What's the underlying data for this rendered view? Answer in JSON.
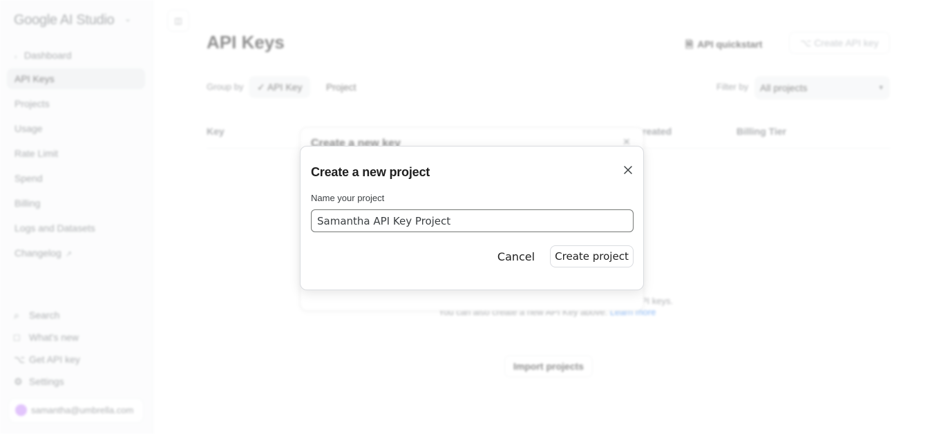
{
  "sidebar": {
    "logo": "Google AI Studio",
    "items": [
      {
        "label": "Dashboard"
      },
      {
        "label": "API Keys"
      },
      {
        "label": "Projects"
      },
      {
        "label": "Usage"
      },
      {
        "label": "Rate Limit"
      },
      {
        "label": "Spend"
      },
      {
        "label": "Billing"
      },
      {
        "label": "Logs and Datasets"
      },
      {
        "label": "Changelog"
      }
    ],
    "footer": [
      {
        "label": "Search"
      },
      {
        "label": "What's new"
      },
      {
        "label": "Get API key"
      },
      {
        "label": "Settings"
      }
    ],
    "account": "samantha@umbrella.com"
  },
  "main": {
    "title": "API Keys",
    "quickstart": "API quickstart",
    "create_key": "Create API key",
    "group_by_label": "Group by",
    "group_options": [
      "API Key",
      "Project"
    ],
    "filter_label": "Filter by",
    "filter_value": "All projects",
    "columns": [
      "Key",
      "Created",
      "Billing Tier"
    ],
    "empty_line1": "Google AI Studio projects to manage your associated API keys.",
    "empty_line2": "You can also create a new API Key above.",
    "learn_more": "Learn more",
    "import_button": "Import projects"
  },
  "back_dialog": {
    "title": "Create a new key"
  },
  "dialog": {
    "title": "Create a new project",
    "field_label": "Name your project",
    "input_value": "Samantha API Key Project",
    "cancel": "Cancel",
    "create": "Create project"
  }
}
